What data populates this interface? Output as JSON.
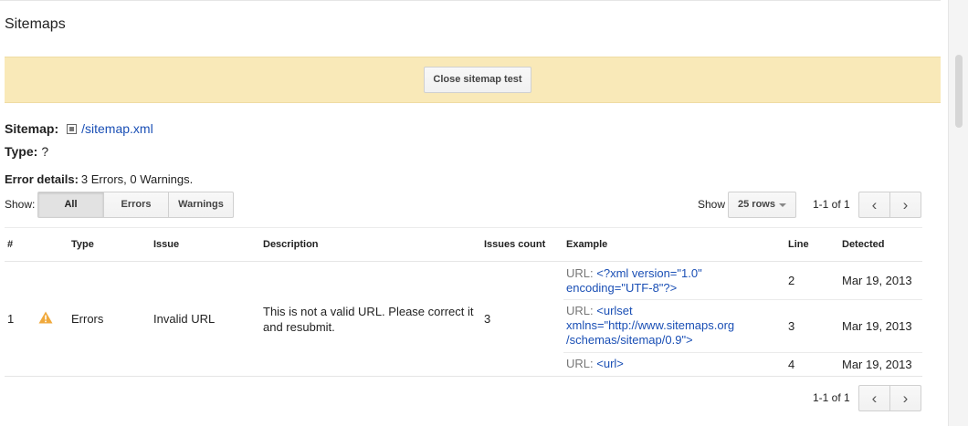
{
  "page": {
    "title": "Sitemaps"
  },
  "banner": {
    "close_button": "Close sitemap test"
  },
  "sitemap": {
    "label": "Sitemap:",
    "link": "/sitemap.xml",
    "icon": "page-icon"
  },
  "type": {
    "label": "Type:",
    "value": "?"
  },
  "error_details": {
    "label": "Error details:",
    "text": "3 Errors, 0 Warnings."
  },
  "filter": {
    "label": "Show:",
    "options": [
      "All",
      "Errors",
      "Warnings"
    ],
    "selected": "All"
  },
  "rows_select": {
    "label": "Show",
    "value": "25 rows"
  },
  "pager": {
    "range_top": "1-1 of 1",
    "range_bottom": "1-1 of 1"
  },
  "table": {
    "headers": [
      "#",
      "Type",
      "Issue",
      "Description",
      "Issues count",
      "Example",
      "Line",
      "Detected"
    ],
    "row": {
      "index": "1",
      "type": "Errors",
      "issue": "Invalid URL",
      "description": "This is not a valid URL. Please correct it and resubmit.",
      "issues_count": "3",
      "status_icon": "warning-icon",
      "examples": [
        {
          "prefix": "URL:",
          "code": "<?xml version=\"1.0\" encoding=\"UTF-8\"?>",
          "line": "2",
          "detected": "Mar 19, 2013"
        },
        {
          "prefix": "URL:",
          "code": "<urlset xmlns=\"http://www.sitemaps.org /schemas/sitemap/0.9\">",
          "line": "3",
          "detected": "Mar 19, 2013"
        },
        {
          "prefix": "URL:",
          "code": "<url>",
          "line": "4",
          "detected": "Mar 19, 2013"
        }
      ]
    }
  },
  "colors": {
    "banner": "#f9e9b8",
    "link": "#1a4fb5",
    "warning": "#f0a93c"
  }
}
